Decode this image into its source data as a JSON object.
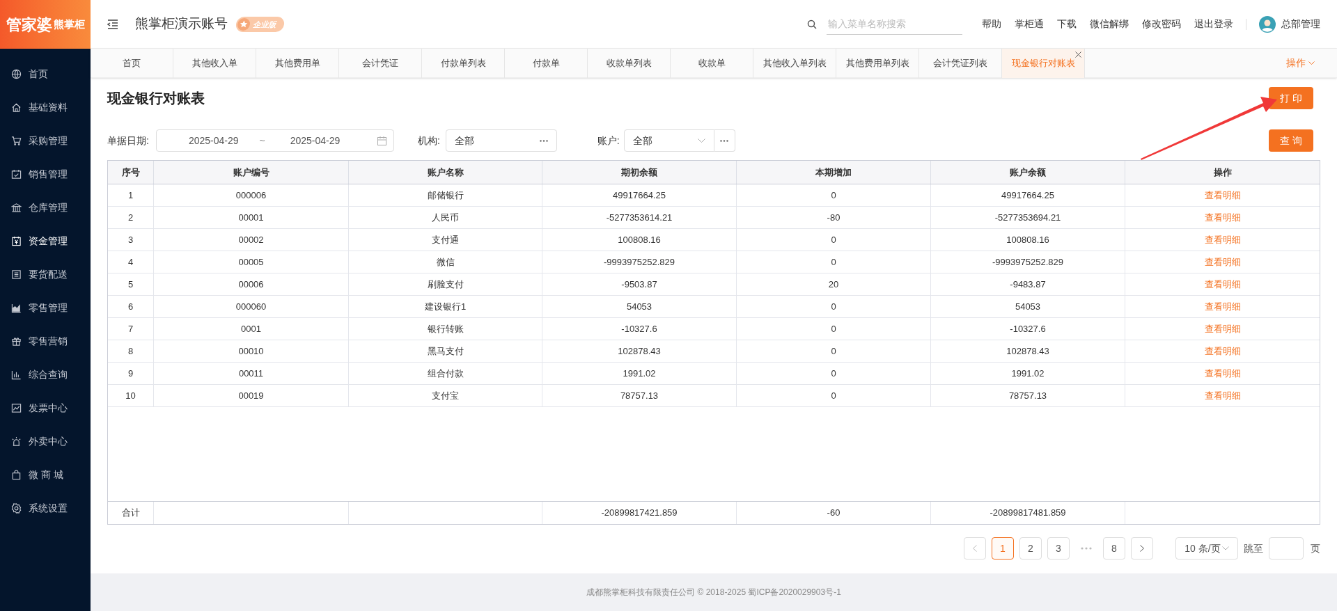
{
  "sidebar": {
    "logo": {
      "main": "管家婆",
      "sub": "熊掌柜"
    },
    "items": [
      {
        "label": "首页",
        "selected": false
      },
      {
        "label": "基础资料",
        "selected": false
      },
      {
        "label": "采购管理",
        "selected": false
      },
      {
        "label": "销售管理",
        "selected": false
      },
      {
        "label": "仓库管理",
        "selected": false
      },
      {
        "label": "资金管理",
        "selected": true
      },
      {
        "label": "要货配送",
        "selected": false
      },
      {
        "label": "零售管理",
        "selected": false
      },
      {
        "label": "零售营销",
        "selected": false
      },
      {
        "label": "综合查询",
        "selected": false
      },
      {
        "label": "发票中心",
        "selected": false
      },
      {
        "label": "外卖中心",
        "selected": false
      },
      {
        "label": "微 商 城",
        "selected": false
      },
      {
        "label": "系统设置",
        "selected": false
      }
    ]
  },
  "header": {
    "account": "熊掌柜演示账号",
    "edition": "企业版",
    "search": {
      "placeholder": "输入菜单名称搜索"
    },
    "links": [
      "帮助",
      "掌柜通",
      "下载",
      "微信解绑",
      "修改密码",
      "退出登录"
    ],
    "user": "总部管理"
  },
  "tabs": [
    {
      "label": "首页",
      "selected": false
    },
    {
      "label": "其他收入单",
      "selected": false
    },
    {
      "label": "其他费用单",
      "selected": false
    },
    {
      "label": "会计凭证",
      "selected": false
    },
    {
      "label": "付款单列表",
      "selected": false
    },
    {
      "label": "付款单",
      "selected": false
    },
    {
      "label": "收款单列表",
      "selected": false
    },
    {
      "label": "收款单",
      "selected": false
    },
    {
      "label": "其他收入单列表",
      "selected": false
    },
    {
      "label": "其他费用单列表",
      "selected": false
    },
    {
      "label": "会计凭证列表",
      "selected": false
    },
    {
      "label": "现金银行对账表",
      "selected": true
    }
  ],
  "tab_actions": "操作",
  "page": {
    "title": "现金银行对账表",
    "print_button": "打 印",
    "query_button": "查 询",
    "filters": {
      "date_label": "单据日期:",
      "date_from": "2025-04-29",
      "date_sep": "~",
      "date_to": "2025-04-29",
      "org_label": "机构:",
      "org_value": "全部",
      "account_label": "账户:",
      "account_value": "全部"
    }
  },
  "table": {
    "columns": [
      "序号",
      "账户编号",
      "账户名称",
      "期初余额",
      "本期增加",
      "账户余额",
      "操作"
    ],
    "rows": [
      [
        "1",
        "000006",
        "邮储银行",
        "49917664.25",
        "0",
        "49917664.25",
        "查看明细"
      ],
      [
        "2",
        "00001",
        "人民币",
        "-5277353614.21",
        "-80",
        "-5277353694.21",
        "查看明细"
      ],
      [
        "3",
        "00002",
        "支付通",
        "100808.16",
        "0",
        "100808.16",
        "查看明细"
      ],
      [
        "4",
        "00005",
        "微信",
        "-9993975252.829",
        "0",
        "-9993975252.829",
        "查看明细"
      ],
      [
        "5",
        "00006",
        "刷脸支付",
        "-9503.87",
        "20",
        "-9483.87",
        "查看明细"
      ],
      [
        "6",
        "000060",
        "建设银行1",
        "54053",
        "0",
        "54053",
        "查看明细"
      ],
      [
        "7",
        "0001",
        "银行转账",
        "-10327.6",
        "0",
        "-10327.6",
        "查看明细"
      ],
      [
        "8",
        "00010",
        "黑马支付",
        "102878.43",
        "0",
        "102878.43",
        "查看明细"
      ],
      [
        "9",
        "00011",
        "组合付款",
        "1991.02",
        "0",
        "1991.02",
        "查看明细"
      ],
      [
        "10",
        "00019",
        "支付宝",
        "78757.13",
        "0",
        "78757.13",
        "查看明细"
      ]
    ],
    "total": {
      "label": "合计",
      "opening": "-20899817421.859",
      "increase": "-60",
      "balance": "-20899817481.859"
    }
  },
  "pagination": {
    "pages": [
      {
        "label": "1",
        "selected": true
      },
      {
        "label": "2",
        "selected": false
      },
      {
        "label": "3",
        "selected": false
      },
      {
        "kind": "ellipsis"
      },
      {
        "label": "8",
        "selected": false
      }
    ],
    "page_size": "10 条/页",
    "jump_label": "跳至",
    "jump_unit": "页"
  },
  "footer": "成都熊掌柜科技有限责任公司 © 2018-2025 蜀ICP备2020029903号-1"
}
